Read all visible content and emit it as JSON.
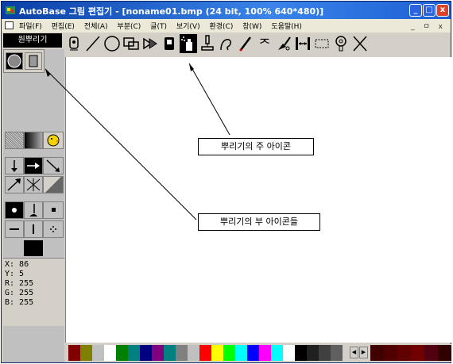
{
  "window": {
    "title": "AutoBase 그림 편집기 - [noname01.bmp (24 bit, 100% 640*480)]",
    "controls": [
      "_",
      "□",
      "x"
    ]
  },
  "menu": {
    "items": [
      "파일(F)",
      "편집(E)",
      "전체(A)",
      "부분(C)",
      "글(T)",
      "보기(V)",
      "환경(C)",
      "창(W)",
      "도움말(H)"
    ],
    "mdi_controls": "_ ㅁ x"
  },
  "brush_label": "원뿌리기",
  "toolbar_icons": [
    "stamp-icon",
    "line-icon",
    "ellipse-icon",
    "rect-icon",
    "fill-icon",
    "eraser-icon",
    "spray-icon",
    "pipette-icon",
    "curve-icon",
    "pencil-icon",
    "text-icon",
    "brush-icon",
    "measure-icon",
    "select-rect-icon",
    "lasso-icon",
    "close-x-icon"
  ],
  "status": {
    "x": "X:  86",
    "y": "Y:  5",
    "r": "R:  255",
    "g": "G:  255",
    "b": "B:  255"
  },
  "callouts": {
    "main_icon": "뿌리기의 주 아이콘",
    "sub_icons": "뿌리기의 부 아이콘들"
  },
  "palette": [
    "#800000",
    "#808000",
    "#c0c0c0",
    "#ffffff",
    "#008000",
    "#008080",
    "#000080",
    "#800080",
    "#008080",
    "#808080",
    "#c0c0c0",
    "#ff0000",
    "#ffff00",
    "#00ff00",
    "#00ffff",
    "#0000ff",
    "#ff00ff",
    "#00ffff",
    "#ffffff",
    "#000000",
    "#202020",
    "#404040",
    "#606060"
  ],
  "palette_tail": [
    "#400000",
    "#500000",
    "#600000",
    "#700000",
    "#500010",
    "#300000"
  ]
}
